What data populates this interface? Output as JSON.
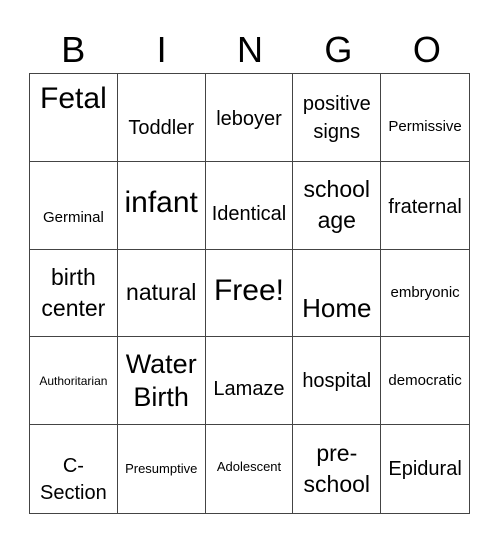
{
  "header": {
    "letters": [
      "B",
      "I",
      "N",
      "G",
      "O"
    ]
  },
  "cells": [
    "Fetal",
    "Toddler",
    "leboyer",
    "positive signs",
    "Permissive",
    "Germinal",
    "infant",
    "Identical",
    "school age",
    "fraternal",
    "birth center",
    "natural",
    "Free!",
    "Home",
    "embryonic",
    "Authoritarian",
    "Water Birth",
    "Lamaze",
    "hospital",
    "democratic",
    "C-Section",
    "Presumptive",
    "Adolescent",
    "pre-school",
    "Epidural"
  ],
  "display": [
    "Fetal",
    "Toddler",
    "leboyer",
    "positive\nsigns",
    "Permissive",
    "Germinal",
    "infant",
    "Identical",
    "school\nage",
    "fraternal",
    "birth\ncenter",
    "natural",
    "Free!",
    "Home",
    "embryonic",
    "Authoritarian",
    "Water\nBirth",
    "Lamaze",
    "hospital",
    "democratic",
    "C-\nSection",
    "Presumptive",
    "Adolescent",
    "pre-\nschool",
    "Epidural"
  ]
}
